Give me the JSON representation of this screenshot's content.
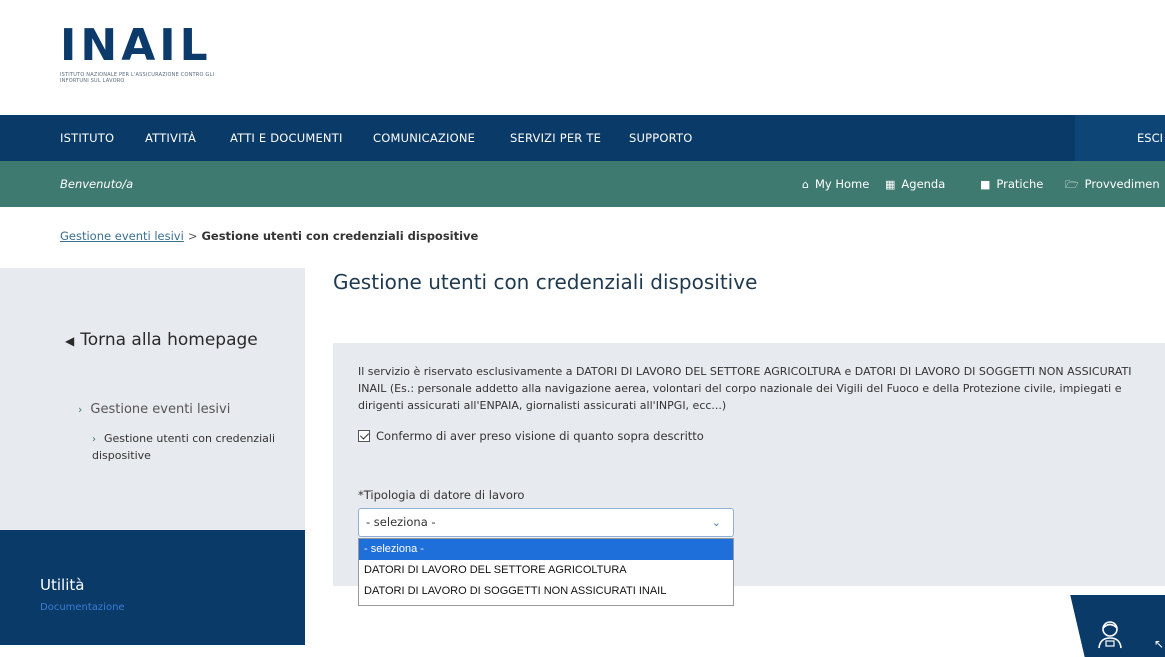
{
  "logo": {
    "mark": "INAIL",
    "subtitle": "ISTITUTO NAZIONALE PER L'ASSICURAZIONE CONTRO GLI INFORTUNI SUL LAVORO"
  },
  "topnav": {
    "items": [
      "ISTITUTO",
      "ATTIVITÀ",
      "ATTI E DOCUMENTI",
      "COMUNICAZIONE",
      "SERVIZI PER TE",
      "SUPPORTO"
    ],
    "logout": "ESCI"
  },
  "subnav": {
    "welcome": "Benvenuto/a",
    "links": [
      {
        "icon": "home-icon",
        "glyph": "⌂",
        "label": "My Home"
      },
      {
        "icon": "calendar-icon",
        "glyph": "▦",
        "label": "Agenda"
      },
      {
        "icon": "folder-icon",
        "glyph": "■",
        "label": "Pratiche"
      },
      {
        "icon": "folder-open-icon",
        "glyph": "🗁",
        "label": "Provvedimen"
      }
    ]
  },
  "breadcrumb": {
    "link": "Gestione eventi lesivi",
    "separator": ">",
    "current": "Gestione utenti con credenziali dispositive"
  },
  "sidebar": {
    "back": "Torna alla homepage",
    "item1": "Gestione eventi lesivi",
    "item2": "Gestione utenti con credenziali dispositive",
    "utility_title": "Utilità",
    "utility_link": "Documentazione"
  },
  "main": {
    "title": "Gestione utenti con credenziali dispositive",
    "info": "Il servizio è riservato esclusivamente a DATORI DI LAVORO DEL SETTORE AGRICOLTURA e DATORI DI LAVORO DI SOGGETTI NON ASSICURATI INAIL (Es.: personale addetto alla navigazione aerea, volontari del corpo nazionale dei Vigili del Fuoco e della Protezione civile, impiegati e dirigenti assicurati all'ENPAIA, giornalisti assicurati all'INPGI, ecc...)",
    "confirm": "Confermo di aver preso visione di quanto sopra descritto",
    "field_label": "*Tipologia di datore di lavoro",
    "select_value": "- seleziona -",
    "options": [
      "- seleziona -",
      "DATORI DI LAVORO DEL SETTORE AGRICOLTURA",
      "DATORI DI LAVORO DI SOGGETTI NON ASSICURATI INAIL"
    ]
  },
  "colors": {
    "navy": "#0a3a67",
    "teal": "#3f7a70",
    "panel": "#e7eaee",
    "highlight": "#1e6fd9"
  }
}
